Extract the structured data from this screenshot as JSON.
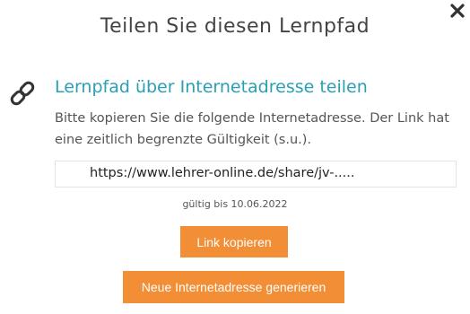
{
  "dialog": {
    "title": "Teilen Sie diesen Lernpfad",
    "close_icon": "close-icon",
    "section": {
      "icon": "link-icon",
      "title": "Lernpfad über Internetadresse teilen",
      "description": "Bitte kopieren Sie die folgende Internetadresse. Der Link hat eine zeitlich begrenzte Gültigkeit (s.u.).",
      "url_value": "https://www.lehrer-online.de/share/jv-.....",
      "validity": "gültig bis 10.06.2022"
    },
    "buttons": {
      "copy_label": "Link kopieren",
      "generate_label": "Neue Internetadresse generieren"
    }
  },
  "colors": {
    "accent_title": "#2a9fb5",
    "button_bg": "#f28e35",
    "text": "#444444"
  }
}
